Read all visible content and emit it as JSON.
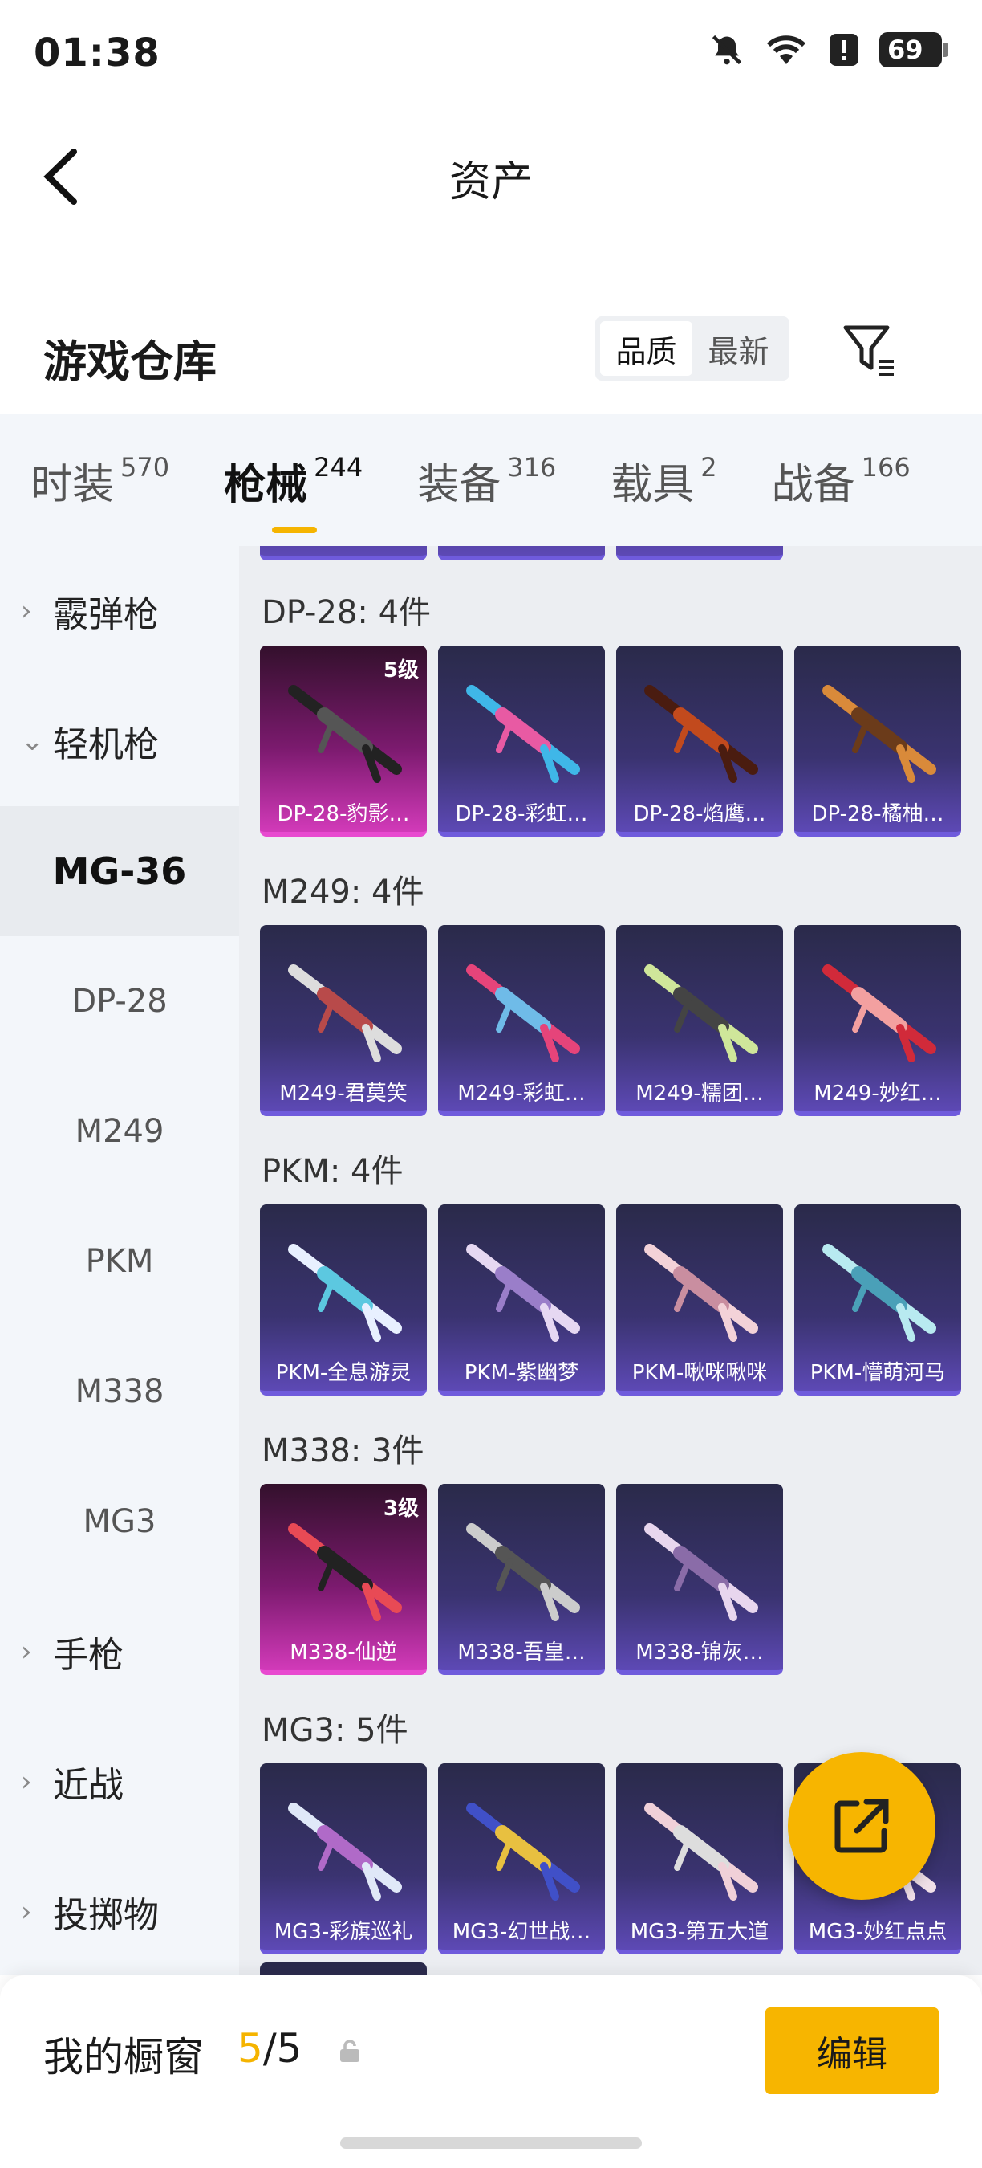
{
  "status": {
    "time": "01:38",
    "battery": "69"
  },
  "header": {
    "title": "资产"
  },
  "section": {
    "title": "游戏仓库",
    "sort_options": [
      "品质",
      "最新"
    ],
    "active_sort": "品质"
  },
  "tabs": [
    {
      "label": "时装",
      "count": "570"
    },
    {
      "label": "枪械",
      "count": "244"
    },
    {
      "label": "装备",
      "count": "316"
    },
    {
      "label": "载具",
      "count": "2"
    },
    {
      "label": "战备",
      "count": "166"
    }
  ],
  "sidebar": {
    "categories": {
      "shotgun": "霰弹枪",
      "lmg": "轻机枪",
      "pistol": "手枪",
      "melee": "近战",
      "throwable": "投掷物"
    },
    "subitems": [
      "MG-36",
      "DP-28",
      "M249",
      "PKM",
      "M338",
      "MG3"
    ]
  },
  "groups": [
    {
      "title": "DP-28: 4件",
      "items": [
        {
          "name": "DP-28-豹影…",
          "level": "5级"
        },
        {
          "name": "DP-28-彩虹…"
        },
        {
          "name": "DP-28-焰鹰…"
        },
        {
          "name": "DP-28-橘柚…"
        }
      ]
    },
    {
      "title": "M249: 4件",
      "items": [
        {
          "name": "M249-君莫笑"
        },
        {
          "name": "M249-彩虹…"
        },
        {
          "name": "M249-糯团…"
        },
        {
          "name": "M249-妙红…"
        }
      ]
    },
    {
      "title": "PKM: 4件",
      "items": [
        {
          "name": "PKM-全息游灵"
        },
        {
          "name": "PKM-紫幽梦"
        },
        {
          "name": "PKM-啾咪啾咪"
        },
        {
          "name": "PKM-懵萌河马"
        }
      ]
    },
    {
      "title": "M338: 3件",
      "items": [
        {
          "name": "M338-仙逆",
          "level": "3级"
        },
        {
          "name": "M338-吾皇…"
        },
        {
          "name": "M338-锦灰…"
        }
      ]
    },
    {
      "title": "MG3: 5件",
      "items": [
        {
          "name": "MG3-彩旗巡礼"
        },
        {
          "name": "MG3-幻世战…"
        },
        {
          "name": "MG3-第五大道"
        },
        {
          "name": "MG3-妙红点点"
        }
      ]
    }
  ],
  "showcase": {
    "label": "我的橱窗",
    "current": "5",
    "separator": "/",
    "total": "5"
  },
  "edit_label": "编辑",
  "colors": {
    "accent": "#F5B400",
    "card_purple": "#5D49B5",
    "card_pink": "#D23AB9"
  },
  "icons": [
    "back-arrow-icon",
    "filter-icon",
    "share-icon",
    "lock-icon",
    "bell-off-icon",
    "wifi-icon",
    "alert-icon"
  ]
}
